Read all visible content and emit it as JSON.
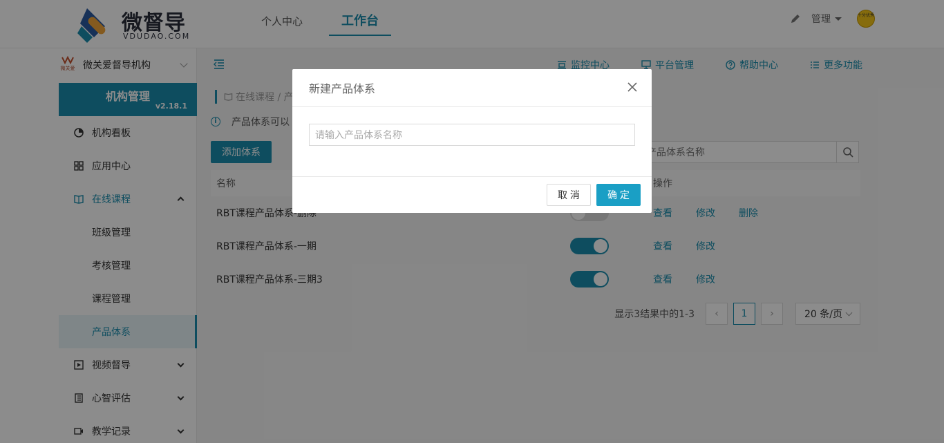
{
  "brand": {
    "name": "微督导",
    "sub": "VDUDAO.COM"
  },
  "topnav": {
    "tabs": [
      {
        "label": "个人中心"
      },
      {
        "label": "工作台"
      }
    ]
  },
  "header": {
    "user": "管理",
    "avatar_text": "十分优秀"
  },
  "org": {
    "logo_text": "微关爱",
    "name": "微关爱督导机构"
  },
  "org_card": {
    "title": "机构管理",
    "version": "v2.18.1"
  },
  "sidebar": {
    "items": [
      {
        "label": "机构看板"
      },
      {
        "label": "应用中心"
      },
      {
        "label": "在线课程"
      },
      {
        "label": "班级管理"
      },
      {
        "label": "考核管理"
      },
      {
        "label": "课程管理"
      },
      {
        "label": "产品体系"
      },
      {
        "label": "视频督导"
      },
      {
        "label": "心智评估"
      },
      {
        "label": "教学记录"
      }
    ]
  },
  "subnav": {
    "items": [
      {
        "label": "监控中心"
      },
      {
        "label": "平台管理"
      },
      {
        "label": "帮助中心"
      },
      {
        "label": "更多功能"
      }
    ]
  },
  "breadcrumb": "在线课程 / 产",
  "tip": "产品体系可以",
  "add_button": "添加体系",
  "search": {
    "placeholder": "产品体系名称"
  },
  "table": {
    "headers": {
      "name": "名称",
      "ops": "操作"
    },
    "rows": [
      {
        "name": "RBT课程产品体系-删除",
        "enabled": false,
        "ops": [
          "查看",
          "修改",
          "删除"
        ]
      },
      {
        "name": "RBT课程产品体系-一期",
        "enabled": true,
        "ops": [
          "查看",
          "修改"
        ]
      },
      {
        "name": "RBT课程产品体系-三期3",
        "enabled": true,
        "ops": [
          "查看",
          "修改"
        ]
      }
    ]
  },
  "pagination": {
    "summary": "显示3结果中的1-3",
    "current": "1",
    "page_size": "20 条/页"
  },
  "modal": {
    "title": "新建产品体系",
    "input_placeholder": "请输入产品体系名称",
    "cancel": "取 消",
    "ok": "确 定"
  },
  "colors": {
    "accent": "#1a8dad",
    "ok_button": "#1a9fc5"
  }
}
